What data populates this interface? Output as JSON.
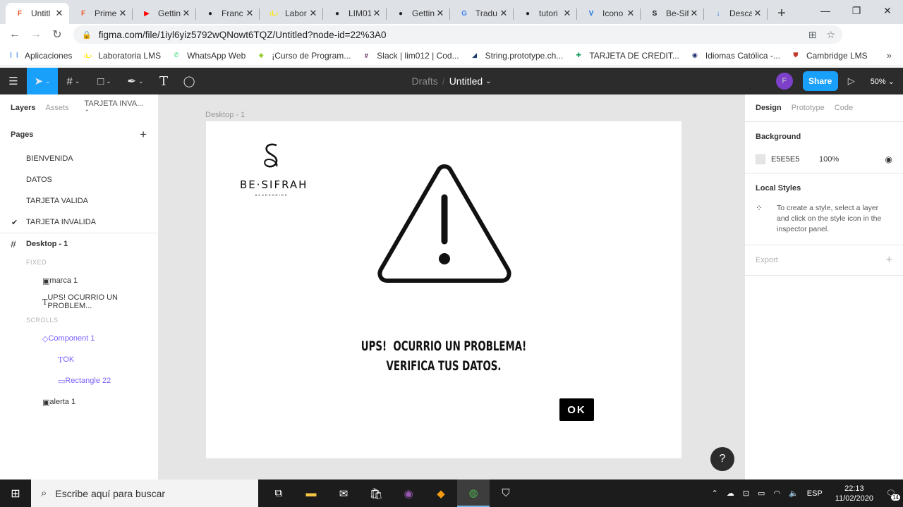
{
  "browser": {
    "tabs": [
      {
        "label": "Untitl",
        "fav": "F",
        "favColor": "#f24e1e",
        "active": true
      },
      {
        "label": "Prime",
        "fav": "F",
        "favColor": "#f24e1e"
      },
      {
        "label": "Gettin",
        "fav": "▶",
        "favColor": "#ff0000"
      },
      {
        "label": "Franc",
        "fav": "●",
        "favColor": "#222222"
      },
      {
        "label": "Labor",
        "fav": "‹L›",
        "favColor": "#ffe600"
      },
      {
        "label": "LIM01",
        "fav": "●",
        "favColor": "#222222"
      },
      {
        "label": "Gettin",
        "fav": "●",
        "favColor": "#222222"
      },
      {
        "label": "Tradu",
        "fav": "G",
        "favColor": "#4285f4"
      },
      {
        "label": "tutori",
        "fav": "●",
        "favColor": "#222222"
      },
      {
        "label": "Icono",
        "fav": "V",
        "favColor": "#1a73e8"
      },
      {
        "label": "Be-Sif",
        "fav": "S",
        "favColor": "#111111"
      },
      {
        "label": "Desca",
        "fav": "↓",
        "favColor": "#1a73e8"
      }
    ],
    "url": "figma.com/file/1iyl6yiz5792wQNowt6TQZ/Untitled?node-id=22%3A0",
    "profile_letter": "F",
    "bookmarks": [
      {
        "label": "Aplicaciones",
        "icon": "⋮⋮",
        "color": "#4285f4"
      },
      {
        "label": "Laboratoria LMS",
        "icon": "‹L›",
        "color": "#ffe600"
      },
      {
        "label": "WhatsApp Web",
        "icon": "✆",
        "color": "#25d366"
      },
      {
        "label": "¡Curso de Program...",
        "icon": "◆",
        "color": "#9acd32"
      },
      {
        "label": "Slack | lim012 | Cod...",
        "icon": "#",
        "color": "#4a154b"
      },
      {
        "label": "String.prototype.ch...",
        "icon": "◢",
        "color": "#1b3d6d"
      },
      {
        "label": "TARJETA DE CREDIT...",
        "icon": "✚",
        "color": "#0f9d58"
      },
      {
        "label": "Idiomas Católica -...",
        "icon": "◉",
        "color": "#1a2a6c"
      },
      {
        "label": "Cambridge LMS",
        "icon": "⛊",
        "color": "#c0392b"
      }
    ]
  },
  "figma": {
    "breadcrumb_drafts": "Drafts",
    "breadcrumb_sep": "/",
    "file_title": "Untitled",
    "share_label": "Share",
    "zoom": "50%",
    "avatar_letter": "F",
    "left_tabs": {
      "layers": "Layers",
      "assets": "Assets",
      "page": "TARJETA INVA..."
    },
    "pages_header": "Pages",
    "pages": [
      "BIENVENIDA",
      "DATOS",
      "TARJETA VALIDA",
      "TARJETA INVALIDA"
    ],
    "frame_name": "Desktop - 1",
    "section_fixed": "FIXED",
    "section_scrolls": "SCROLLS",
    "layers": {
      "marca": "marca 1",
      "text": "UPS! OCURRIO UN PROBLEM...",
      "component": "Component 1",
      "ok": "OK",
      "rect": "Rectangle 22",
      "alerta": "alerta 1"
    },
    "right_tabs": {
      "design": "Design",
      "prototype": "Prototype",
      "code": "Code"
    },
    "background_title": "Background",
    "background_hex": "E5E5E5",
    "background_opacity": "100%",
    "local_styles_title": "Local Styles",
    "local_styles_hint": "To create a style, select a layer and click on the style icon in the inspector panel.",
    "export_title": "Export"
  },
  "design": {
    "frame_label": "Desktop - 1",
    "brand_name": "BE·SIFRAH",
    "brand_sub": "ACCESORIOS",
    "message_line1": "UPS!  OCURRIO UN PROBLEMA!",
    "message_line2": "VERIFICA TUS DATOS.",
    "ok_label": "OK"
  },
  "taskbar": {
    "search_placeholder": "Escribe aquí para buscar",
    "lang": "ESP",
    "time": "22:13",
    "date": "11/02/2020",
    "notifications": "14"
  }
}
